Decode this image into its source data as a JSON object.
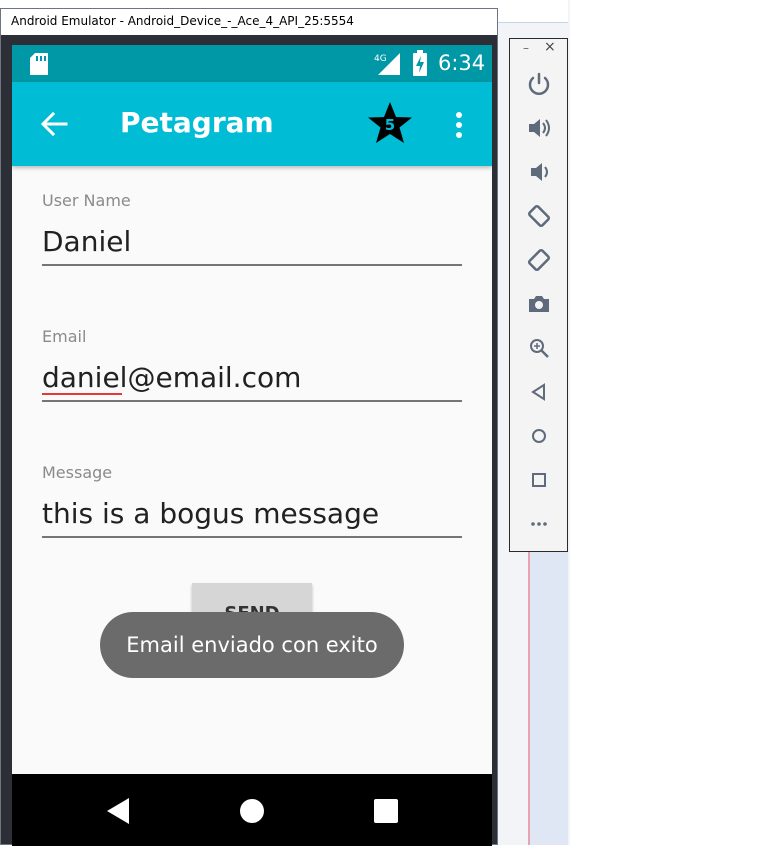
{
  "window": {
    "title": "Android Emulator - Android_Device_-_Ace_4_API_25:5554"
  },
  "status_bar": {
    "network": "4G",
    "time": "6:34",
    "colors": {
      "status": "#0097a7",
      "app_bar": "#00bcd4"
    }
  },
  "app_bar": {
    "title": "Petagram",
    "back_icon": "arrow-left-icon",
    "badge_count": "5",
    "menu_icon": "more-vert-icon"
  },
  "form": {
    "user_name": {
      "label": "User Name",
      "value": "Daniel"
    },
    "email": {
      "label": "Email",
      "value": "daniel@email.com"
    },
    "message": {
      "label": "Message",
      "value": "this is a bogus message"
    },
    "send_label": "SEND"
  },
  "toast": {
    "text": "Email enviado con exito"
  },
  "emulator_toolbar": {
    "minimize": "–",
    "close": "×",
    "buttons": [
      "power-icon",
      "volume-up-icon",
      "volume-down-icon",
      "rotate-left-icon",
      "rotate-right-icon",
      "camera-icon",
      "zoom-icon",
      "back-icon",
      "home-icon",
      "overview-icon",
      "more-icon"
    ]
  }
}
